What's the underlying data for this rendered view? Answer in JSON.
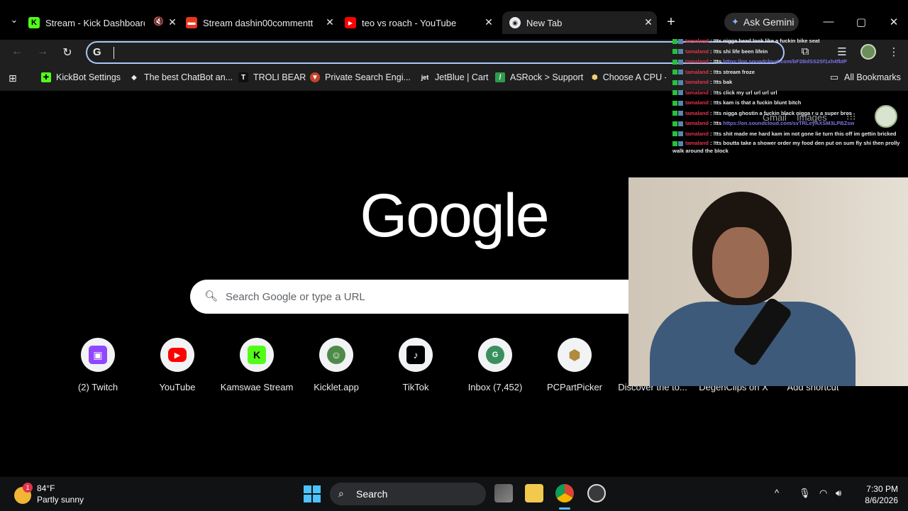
{
  "tabs": [
    {
      "title": "Stream - Kick Dashboard",
      "favicon": "kick-icon"
    },
    {
      "title": "Stream dashin00commentt n",
      "favicon": "stream-icon"
    },
    {
      "title": "teo vs roach - YouTube",
      "favicon": "youtube-icon"
    },
    {
      "title": "New Tab",
      "favicon": "chrome-icon",
      "active": true
    }
  ],
  "toolbar": {
    "omnibox_g": "G",
    "gemini_label": "Ask Gemini"
  },
  "bookmarks": [
    {
      "label": "KickBot Settings"
    },
    {
      "label": "The best ChatBot an..."
    },
    {
      "label": "TROLI BEAR"
    },
    {
      "label": "Private Search Engi..."
    },
    {
      "label": "JetBlue | Cart"
    },
    {
      "label": "ASRock > Support"
    },
    {
      "label": "Choose A CPU - PC"
    }
  ],
  "all_bookmarks": "All Bookmarks",
  "ntp": {
    "logo": "Google",
    "search_placeholder": "Search Google or type a URL",
    "gmail": "Gmail",
    "images": "Images",
    "shortcuts": [
      {
        "label": "(2) Twitch",
        "color": "#9146ff"
      },
      {
        "label": "YouTube",
        "color": "#ff0000"
      },
      {
        "label": "Kamswae Stream",
        "color": "#53fc18"
      },
      {
        "label": "Kicklet.app",
        "color": "#4f8a4a"
      },
      {
        "label": "TikTok",
        "color": "#000000"
      },
      {
        "label": "Inbox (7,452)",
        "color": "#3a8f5f",
        "letter": "G"
      },
      {
        "label": "PCPartPicker",
        "color": "#ffffff"
      },
      {
        "label": "Discover the to..."
      },
      {
        "label": "DegenClips on X"
      },
      {
        "label": "Add shortcut"
      }
    ]
  },
  "chat": [
    {
      "user": "tamaland",
      "text": "!tts nigga head look like a fuckin bike seat"
    },
    {
      "user": "tamaland",
      "text": "!tts shi life been lifein"
    },
    {
      "user": "tamaland",
      "text": "!tts",
      "link": "https://on.soundcloud.com/bF2BdSS2Sf1xh4fbIP"
    },
    {
      "user": "tamaland",
      "text": "!tts stream froze"
    },
    {
      "user": "tamaland",
      "text": "!tts bak"
    },
    {
      "user": "tamaland",
      "text": "!tts click my url url url url"
    },
    {
      "user": "tamaland",
      "text": "!tts kam is that a fuckin blunt bitch"
    },
    {
      "user": "tamaland",
      "text": "!tts nigga ghostin a fuckin black nigga r u a super bros"
    },
    {
      "user": "tamaland",
      "text": "!tts",
      "link": "https://on.soundcloud.com/svTRLeyAXSM3LPBZsw"
    },
    {
      "user": "tamaland",
      "text": "!tts shit made me hard kam im not gone lie turn this off im gettin bricked"
    },
    {
      "user": "tamaland",
      "text": "!tts boutta take a shower order my food den put on sum fly shi then prolly walk around the block"
    }
  ],
  "taskbar": {
    "temp": "84°F",
    "condition": "Partly sunny",
    "weather_badge": "1",
    "search": "Search",
    "time": "7:30 PM",
    "date": "8/6/2026"
  }
}
